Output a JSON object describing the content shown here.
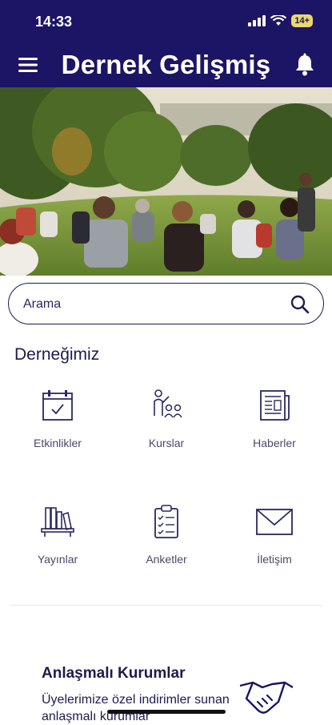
{
  "status_bar": {
    "time": "14:33",
    "battery": "14+"
  },
  "app_bar": {
    "title": "Dernek Gelişmiş"
  },
  "search": {
    "placeholder": "Arama"
  },
  "section": {
    "title": "Derneğimiz"
  },
  "grid": {
    "items": [
      {
        "label": "Etkinlikler",
        "icon": "calendar-check-icon"
      },
      {
        "label": "Kurslar",
        "icon": "teacher-students-icon"
      },
      {
        "label": "Haberler",
        "icon": "newspaper-icon"
      },
      {
        "label": "Yayınlar",
        "icon": "bookshelf-icon"
      },
      {
        "label": "Anketler",
        "icon": "clipboard-checklist-icon"
      },
      {
        "label": "İletişim",
        "icon": "envelope-icon"
      }
    ]
  },
  "partner": {
    "title": "Anlaşmalı Kurumlar",
    "subtitle": "Üyelerimize özel indirimler sunan anlaşmalı kurumlar",
    "icon": "handshake-icon"
  },
  "colors": {
    "primary": "#1c1464",
    "text": "#1f1b4d",
    "muted": "#4a4a66"
  }
}
